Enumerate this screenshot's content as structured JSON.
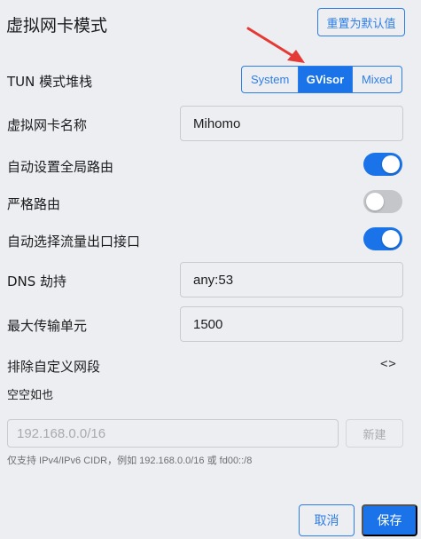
{
  "header": {
    "title": "虚拟网卡模式",
    "reset_label": "重置为默认值"
  },
  "colors": {
    "accent": "#1a73e8",
    "annotation_arrow": "#e53935"
  },
  "tun_stack": {
    "label": "TUN 模式堆栈",
    "options": [
      "System",
      "GVisor",
      "Mixed"
    ],
    "selected": "GVisor"
  },
  "device_name": {
    "label": "虚拟网卡名称",
    "value": "Mihomo"
  },
  "auto_route": {
    "label": "自动设置全局路由",
    "enabled": true
  },
  "strict_route": {
    "label": "严格路由",
    "enabled": false
  },
  "auto_detect_interface": {
    "label": "自动选择流量出口接口",
    "enabled": true
  },
  "dns_hijack": {
    "label": "DNS 劫持",
    "value": "any:53"
  },
  "mtu": {
    "label": "最大传输单元",
    "value": "1500"
  },
  "exclude_cidr": {
    "label": "排除自定义网段",
    "toggle_icon": "code-icon",
    "empty_text": "空空如也",
    "placeholder": "192.168.0.0/16",
    "add_label": "新建",
    "hint": "仅支持 IPv4/IPv6 CIDR，例如 192.168.0.0/16 或 fd00::/8"
  },
  "footer": {
    "cancel_label": "取消",
    "save_label": "保存"
  }
}
